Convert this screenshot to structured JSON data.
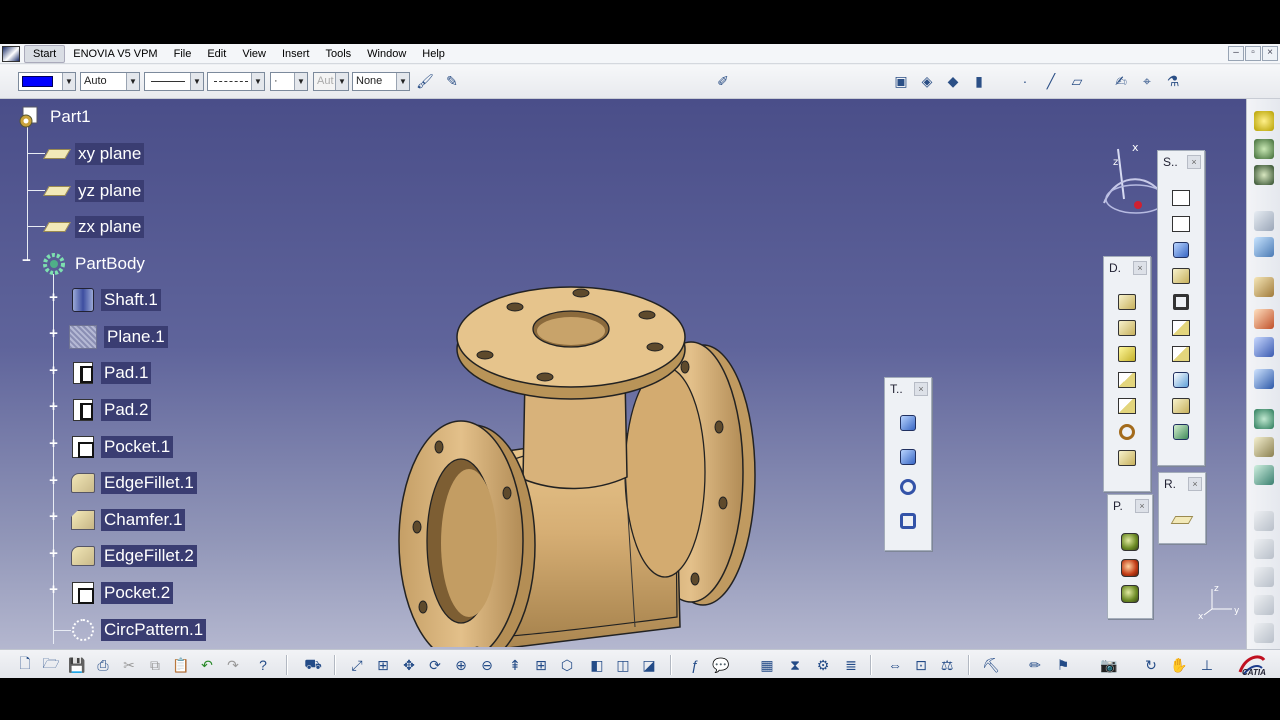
{
  "menubar": {
    "items": [
      "Start",
      "ENOVIA V5 VPM",
      "File",
      "Edit",
      "View",
      "Insert",
      "Tools",
      "Window",
      "Help"
    ],
    "window_controls": [
      "–",
      "▫",
      "×"
    ]
  },
  "properties_toolbar": {
    "color_value": "#0000ff",
    "transparency_value": "Auto",
    "linetype_value": "",
    "linestyle_value": "",
    "point_value": "·",
    "layer_value": "Aut",
    "render_value": "None"
  },
  "spec_tree": {
    "root": "Part1",
    "planes": [
      "xy plane",
      "yz plane",
      "zx plane"
    ],
    "body": "PartBody",
    "features": [
      {
        "label": "Shaft.1",
        "icon": "shaft-icon"
      },
      {
        "label": "Plane.1",
        "icon": "plane-icon"
      },
      {
        "label": "Pad.1",
        "icon": "pad-icon"
      },
      {
        "label": "Pad.2",
        "icon": "pad-icon"
      },
      {
        "label": "Pocket.1",
        "icon": "pocket-icon"
      },
      {
        "label": "EdgeFillet.1",
        "icon": "edge-fillet-icon"
      },
      {
        "label": "Chamfer.1",
        "icon": "chamfer-icon"
      },
      {
        "label": "EdgeFillet.2",
        "icon": "edge-fillet-icon"
      },
      {
        "label": "Pocket.2",
        "icon": "pocket-icon"
      },
      {
        "label": "CircPattern.1",
        "icon": "circular-pattern-icon"
      }
    ]
  },
  "floating_toolbars": {
    "t": {
      "title": "T..",
      "close": "×"
    },
    "d": {
      "title": "D.",
      "close": "×"
    },
    "s": {
      "title": "S..",
      "close": "×"
    },
    "r": {
      "title": "R.",
      "close": "×"
    },
    "p": {
      "title": "P.",
      "close": "×"
    }
  },
  "compass": {
    "x_label": "x",
    "z_label": "z"
  },
  "axis_triad": {
    "x": "x",
    "y": "y",
    "z": "z"
  },
  "brand": {
    "logo_text": "CATIA"
  },
  "colors": {
    "viewport_top": "#4a4e89",
    "viewport_bottom": "#b4b7cf",
    "part_color": "#d8b27a",
    "selection": "#3a3d72"
  }
}
